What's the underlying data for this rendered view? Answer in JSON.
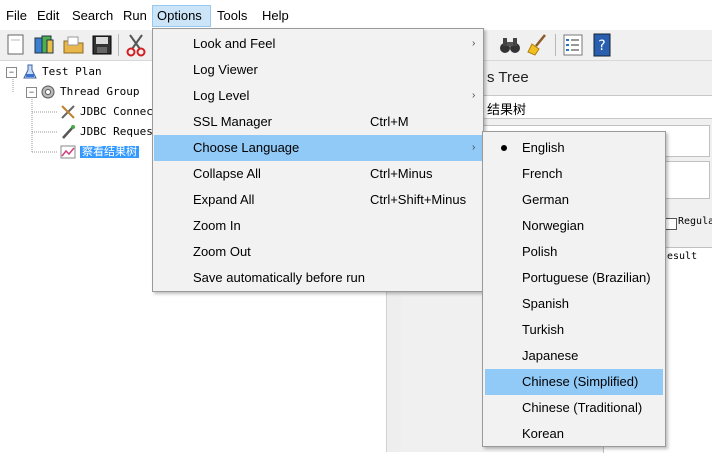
{
  "menubar": {
    "items": [
      {
        "label": "File"
      },
      {
        "label": "Edit"
      },
      {
        "label": "Search"
      },
      {
        "label": "Run"
      },
      {
        "label": "Options"
      },
      {
        "label": "Tools"
      },
      {
        "label": "Help"
      }
    ]
  },
  "toolbar": {
    "buttons": [
      "new-icon",
      "templates-icon",
      "open-icon",
      "save-icon",
      "cut-icon",
      "binoculars-icon",
      "broom-icon",
      "function-list-icon",
      "help-icon"
    ]
  },
  "tree": {
    "nodes": [
      {
        "label": "Test Plan",
        "icon": "test-plan-icon"
      },
      {
        "label": "Thread Group",
        "icon": "thread-group-icon"
      },
      {
        "label": "JDBC Connect",
        "icon": "jdbc-connection-icon"
      },
      {
        "label": "JDBC Request",
        "icon": "jdbc-request-icon"
      },
      {
        "label": "察看结果树",
        "icon": "results-tree-icon"
      }
    ]
  },
  "right_panel": {
    "title": "s Tree",
    "name_value": "结果树",
    "regular_label": "Regular",
    "result_tab": "esult"
  },
  "options_menu": {
    "items": [
      {
        "label": "Look and Feel",
        "shortcut": "",
        "arrow": "›"
      },
      {
        "label": "Log Viewer",
        "shortcut": "",
        "arrow": ""
      },
      {
        "label": "Log Level",
        "shortcut": "",
        "arrow": "›"
      },
      {
        "label": "SSL Manager",
        "shortcut": "Ctrl+M",
        "arrow": ""
      },
      {
        "label": "Choose Language",
        "shortcut": "",
        "arrow": "›"
      },
      {
        "label": "Collapse All",
        "shortcut": "Ctrl+Minus",
        "arrow": ""
      },
      {
        "label": "Expand All",
        "shortcut": "Ctrl+Shift+Minus",
        "arrow": ""
      },
      {
        "label": "Zoom In",
        "shortcut": "",
        "arrow": ""
      },
      {
        "label": "Zoom Out",
        "shortcut": "",
        "arrow": ""
      },
      {
        "label": "Save automatically before run",
        "shortcut": "",
        "arrow": ""
      }
    ]
  },
  "language_menu": {
    "selected": "English",
    "highlighted": "Chinese (Simplified)",
    "items": [
      {
        "label": "English"
      },
      {
        "label": "French"
      },
      {
        "label": "German"
      },
      {
        "label": "Norwegian"
      },
      {
        "label": "Polish"
      },
      {
        "label": "Portuguese (Brazilian)"
      },
      {
        "label": "Spanish"
      },
      {
        "label": "Turkish"
      },
      {
        "label": "Japanese"
      },
      {
        "label": "Chinese (Simplified)"
      },
      {
        "label": "Chinese (Traditional)"
      },
      {
        "label": "Korean"
      }
    ]
  },
  "colors": {
    "menu_highlight": "#91c9f7",
    "active_menu": "#cce4f7",
    "tree_selection": "#3399ff"
  }
}
